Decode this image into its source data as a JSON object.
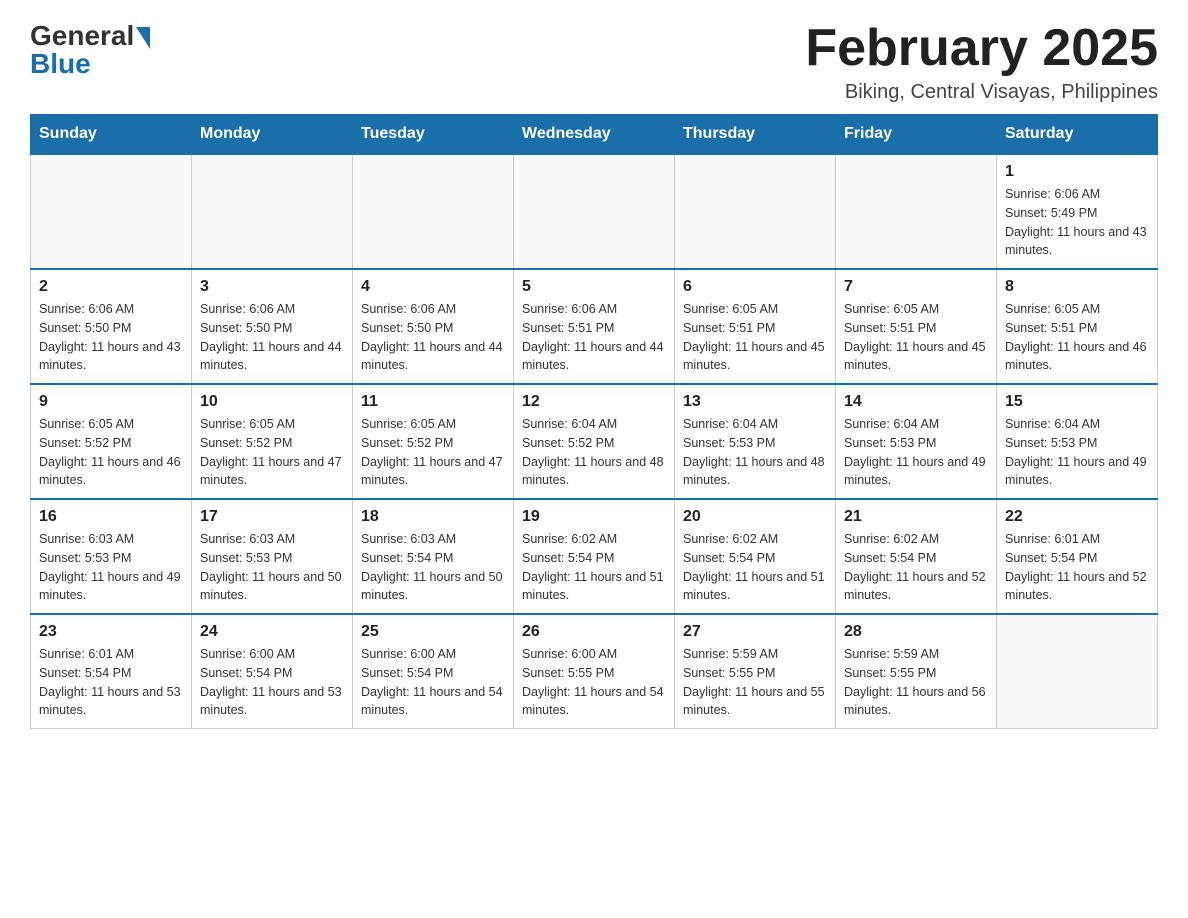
{
  "header": {
    "logo_general": "General",
    "logo_blue": "Blue",
    "month_title": "February 2025",
    "subtitle": "Biking, Central Visayas, Philippines"
  },
  "days_of_week": [
    "Sunday",
    "Monday",
    "Tuesday",
    "Wednesday",
    "Thursday",
    "Friday",
    "Saturday"
  ],
  "weeks": [
    [
      {
        "day": "",
        "sunrise": "",
        "sunset": "",
        "daylight": ""
      },
      {
        "day": "",
        "sunrise": "",
        "sunset": "",
        "daylight": ""
      },
      {
        "day": "",
        "sunrise": "",
        "sunset": "",
        "daylight": ""
      },
      {
        "day": "",
        "sunrise": "",
        "sunset": "",
        "daylight": ""
      },
      {
        "day": "",
        "sunrise": "",
        "sunset": "",
        "daylight": ""
      },
      {
        "day": "",
        "sunrise": "",
        "sunset": "",
        "daylight": ""
      },
      {
        "day": "1",
        "sunrise": "Sunrise: 6:06 AM",
        "sunset": "Sunset: 5:49 PM",
        "daylight": "Daylight: 11 hours and 43 minutes."
      }
    ],
    [
      {
        "day": "2",
        "sunrise": "Sunrise: 6:06 AM",
        "sunset": "Sunset: 5:50 PM",
        "daylight": "Daylight: 11 hours and 43 minutes."
      },
      {
        "day": "3",
        "sunrise": "Sunrise: 6:06 AM",
        "sunset": "Sunset: 5:50 PM",
        "daylight": "Daylight: 11 hours and 44 minutes."
      },
      {
        "day": "4",
        "sunrise": "Sunrise: 6:06 AM",
        "sunset": "Sunset: 5:50 PM",
        "daylight": "Daylight: 11 hours and 44 minutes."
      },
      {
        "day": "5",
        "sunrise": "Sunrise: 6:06 AM",
        "sunset": "Sunset: 5:51 PM",
        "daylight": "Daylight: 11 hours and 44 minutes."
      },
      {
        "day": "6",
        "sunrise": "Sunrise: 6:05 AM",
        "sunset": "Sunset: 5:51 PM",
        "daylight": "Daylight: 11 hours and 45 minutes."
      },
      {
        "day": "7",
        "sunrise": "Sunrise: 6:05 AM",
        "sunset": "Sunset: 5:51 PM",
        "daylight": "Daylight: 11 hours and 45 minutes."
      },
      {
        "day": "8",
        "sunrise": "Sunrise: 6:05 AM",
        "sunset": "Sunset: 5:51 PM",
        "daylight": "Daylight: 11 hours and 46 minutes."
      }
    ],
    [
      {
        "day": "9",
        "sunrise": "Sunrise: 6:05 AM",
        "sunset": "Sunset: 5:52 PM",
        "daylight": "Daylight: 11 hours and 46 minutes."
      },
      {
        "day": "10",
        "sunrise": "Sunrise: 6:05 AM",
        "sunset": "Sunset: 5:52 PM",
        "daylight": "Daylight: 11 hours and 47 minutes."
      },
      {
        "day": "11",
        "sunrise": "Sunrise: 6:05 AM",
        "sunset": "Sunset: 5:52 PM",
        "daylight": "Daylight: 11 hours and 47 minutes."
      },
      {
        "day": "12",
        "sunrise": "Sunrise: 6:04 AM",
        "sunset": "Sunset: 5:52 PM",
        "daylight": "Daylight: 11 hours and 48 minutes."
      },
      {
        "day": "13",
        "sunrise": "Sunrise: 6:04 AM",
        "sunset": "Sunset: 5:53 PM",
        "daylight": "Daylight: 11 hours and 48 minutes."
      },
      {
        "day": "14",
        "sunrise": "Sunrise: 6:04 AM",
        "sunset": "Sunset: 5:53 PM",
        "daylight": "Daylight: 11 hours and 49 minutes."
      },
      {
        "day": "15",
        "sunrise": "Sunrise: 6:04 AM",
        "sunset": "Sunset: 5:53 PM",
        "daylight": "Daylight: 11 hours and 49 minutes."
      }
    ],
    [
      {
        "day": "16",
        "sunrise": "Sunrise: 6:03 AM",
        "sunset": "Sunset: 5:53 PM",
        "daylight": "Daylight: 11 hours and 49 minutes."
      },
      {
        "day": "17",
        "sunrise": "Sunrise: 6:03 AM",
        "sunset": "Sunset: 5:53 PM",
        "daylight": "Daylight: 11 hours and 50 minutes."
      },
      {
        "day": "18",
        "sunrise": "Sunrise: 6:03 AM",
        "sunset": "Sunset: 5:54 PM",
        "daylight": "Daylight: 11 hours and 50 minutes."
      },
      {
        "day": "19",
        "sunrise": "Sunrise: 6:02 AM",
        "sunset": "Sunset: 5:54 PM",
        "daylight": "Daylight: 11 hours and 51 minutes."
      },
      {
        "day": "20",
        "sunrise": "Sunrise: 6:02 AM",
        "sunset": "Sunset: 5:54 PM",
        "daylight": "Daylight: 11 hours and 51 minutes."
      },
      {
        "day": "21",
        "sunrise": "Sunrise: 6:02 AM",
        "sunset": "Sunset: 5:54 PM",
        "daylight": "Daylight: 11 hours and 52 minutes."
      },
      {
        "day": "22",
        "sunrise": "Sunrise: 6:01 AM",
        "sunset": "Sunset: 5:54 PM",
        "daylight": "Daylight: 11 hours and 52 minutes."
      }
    ],
    [
      {
        "day": "23",
        "sunrise": "Sunrise: 6:01 AM",
        "sunset": "Sunset: 5:54 PM",
        "daylight": "Daylight: 11 hours and 53 minutes."
      },
      {
        "day": "24",
        "sunrise": "Sunrise: 6:00 AM",
        "sunset": "Sunset: 5:54 PM",
        "daylight": "Daylight: 11 hours and 53 minutes."
      },
      {
        "day": "25",
        "sunrise": "Sunrise: 6:00 AM",
        "sunset": "Sunset: 5:54 PM",
        "daylight": "Daylight: 11 hours and 54 minutes."
      },
      {
        "day": "26",
        "sunrise": "Sunrise: 6:00 AM",
        "sunset": "Sunset: 5:55 PM",
        "daylight": "Daylight: 11 hours and 54 minutes."
      },
      {
        "day": "27",
        "sunrise": "Sunrise: 5:59 AM",
        "sunset": "Sunset: 5:55 PM",
        "daylight": "Daylight: 11 hours and 55 minutes."
      },
      {
        "day": "28",
        "sunrise": "Sunrise: 5:59 AM",
        "sunset": "Sunset: 5:55 PM",
        "daylight": "Daylight: 11 hours and 56 minutes."
      },
      {
        "day": "",
        "sunrise": "",
        "sunset": "",
        "daylight": ""
      }
    ]
  ]
}
